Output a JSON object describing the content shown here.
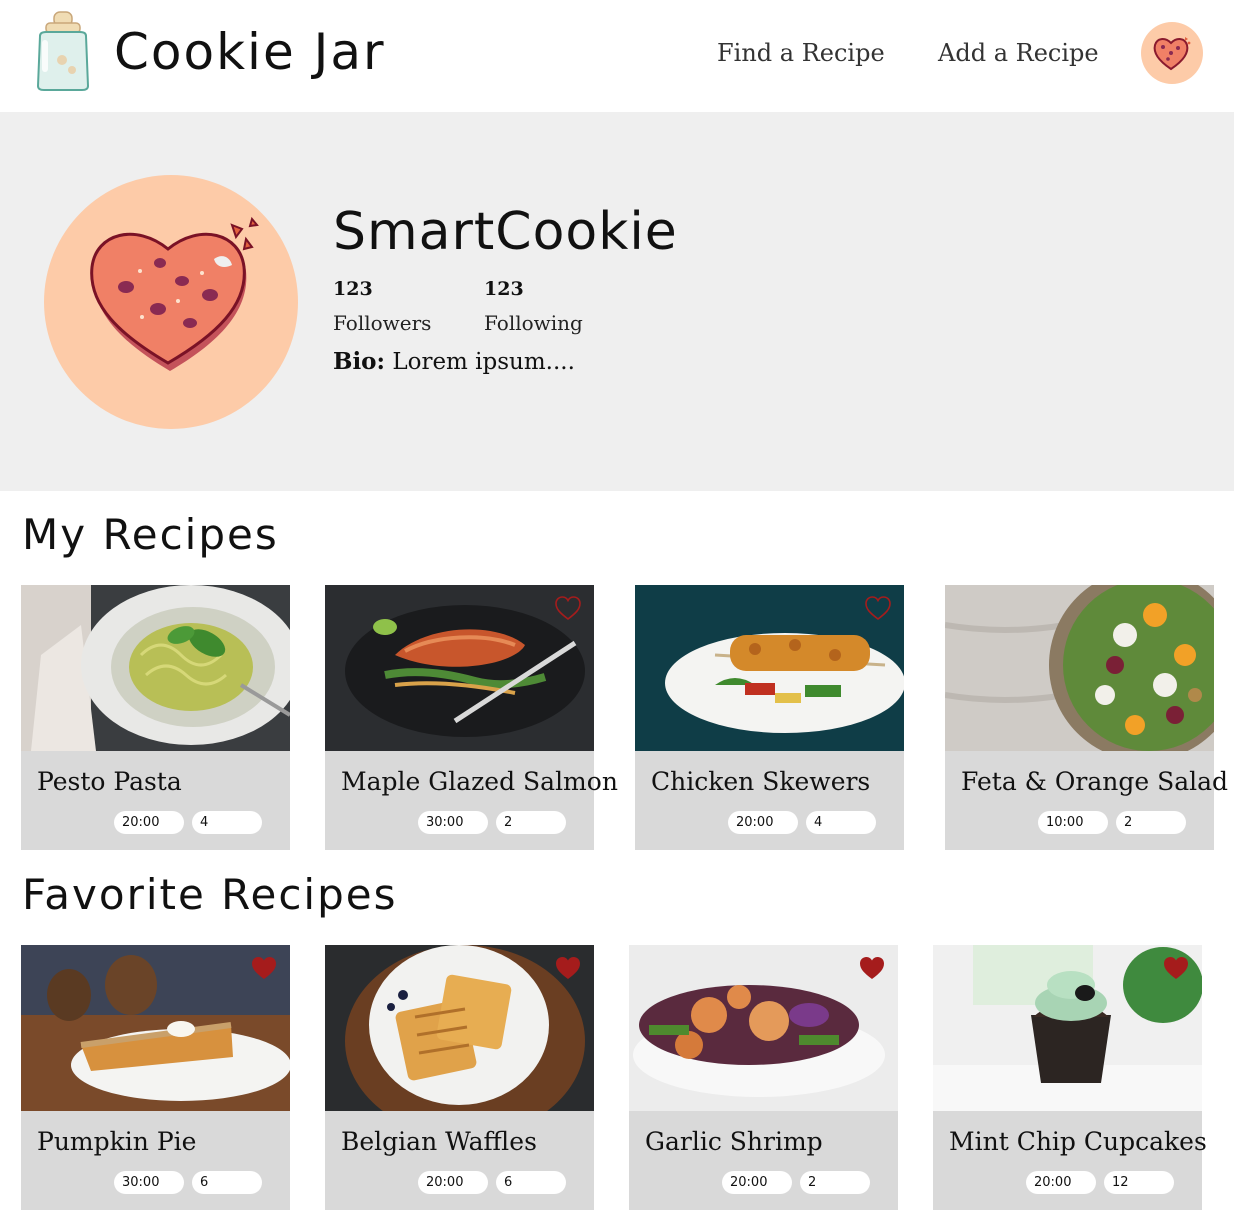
{
  "header": {
    "app_title": "Cookie Jar",
    "nav": [
      {
        "label": "Find a Recipe"
      },
      {
        "label": "Add a Recipe"
      }
    ]
  },
  "profile": {
    "username": "SmartCookie",
    "followers_count": "123",
    "followers_label": "Followers",
    "following_count": "123",
    "following_label": "Following",
    "bio_label": "Bio:",
    "bio_text": " Lorem ipsum...."
  },
  "sections": {
    "my_recipes_title": "My Recipes",
    "favorite_recipes_title": "Favorite Recipes"
  },
  "my_recipes": [
    {
      "name": "Pesto Pasta",
      "time": "20:00",
      "servings": "4",
      "favorited": false,
      "heart_visible": false
    },
    {
      "name": "Maple Glazed Salmon",
      "time": "30:00",
      "servings": "2",
      "favorited": false,
      "heart_visible": true
    },
    {
      "name": "Chicken Skewers",
      "time": "20:00",
      "servings": "4",
      "favorited": false,
      "heart_visible": true
    },
    {
      "name": "Feta & Orange Salad",
      "time": "10:00",
      "servings": "2",
      "favorited": false,
      "heart_visible": false
    }
  ],
  "favorite_recipes": [
    {
      "name": "Pumpkin Pie",
      "time": "30:00",
      "servings": "6",
      "favorited": true
    },
    {
      "name": "Belgian Waffles",
      "time": "20:00",
      "servings": "6",
      "favorited": true
    },
    {
      "name": "Garlic Shrimp",
      "time": "20:00",
      "servings": "2",
      "favorited": true
    },
    {
      "name": "Mint Chip Cupcakes",
      "time": "20:00",
      "servings": "12",
      "favorited": true
    }
  ],
  "colors": {
    "avatar_bg": "#fdcba8",
    "profile_bg": "#efefef",
    "card_bg": "#d9d9d9",
    "heart_filled": "#a51c1c"
  }
}
